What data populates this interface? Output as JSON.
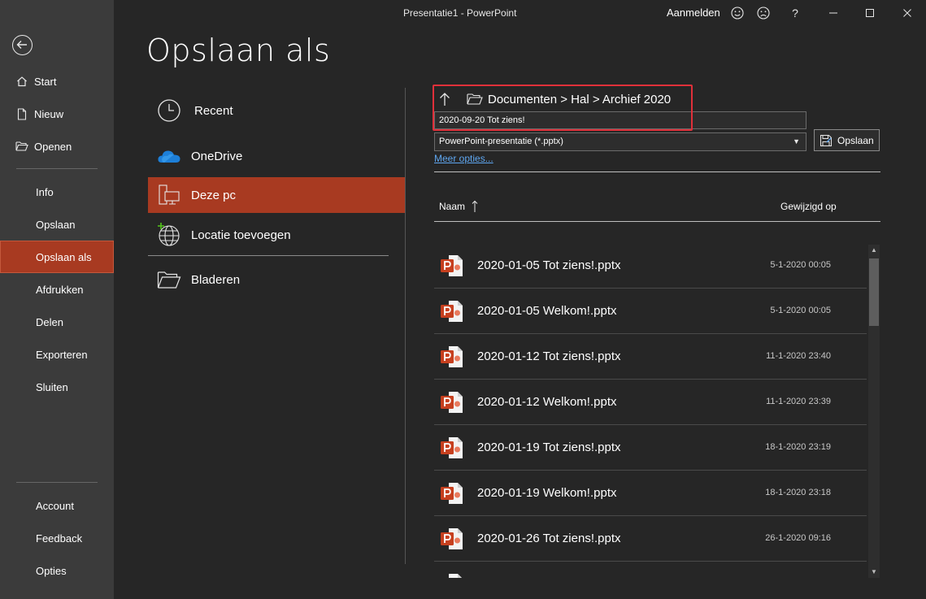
{
  "window": {
    "title": "Presentatie1  -  PowerPoint",
    "signin": "Aanmelden",
    "icons": [
      "smiley-icon",
      "frown-icon",
      "help-icon",
      "minimize-icon",
      "maximize-icon",
      "close-icon"
    ],
    "help_glyph": "?"
  },
  "sidebar": {
    "items": [
      {
        "label": "Start",
        "icon": "home-icon"
      },
      {
        "label": "Nieuw",
        "icon": "new-document-icon"
      },
      {
        "label": "Openen",
        "icon": "folder-open-icon"
      },
      {
        "label": "Info"
      },
      {
        "label": "Opslaan"
      },
      {
        "label": "Opslaan als",
        "selected": true
      },
      {
        "label": "Afdrukken"
      },
      {
        "label": "Delen"
      },
      {
        "label": "Exporteren"
      },
      {
        "label": "Sluiten"
      },
      {
        "label": "Account"
      },
      {
        "label": "Feedback"
      },
      {
        "label": "Opties"
      }
    ],
    "accent_color": "#a83a21"
  },
  "page": {
    "title": "Opslaan als"
  },
  "locations": [
    {
      "label": "Recent",
      "icon": "clock-icon"
    },
    {
      "label": "OneDrive",
      "icon": "onedrive-cloud-icon"
    },
    {
      "label": "Deze pc",
      "icon": "this-pc-icon",
      "selected": true
    },
    {
      "label": "Locatie toevoegen",
      "icon": "add-location-globe-icon"
    },
    {
      "label": "Bladeren",
      "icon": "folder-browse-icon"
    }
  ],
  "save": {
    "breadcrumb": "Documenten > Hal > Archief 2020",
    "filename": "2020-09-20 Tot ziens!",
    "filetype": "PowerPoint-presentatie (*.pptx)",
    "save_label": "Opslaan",
    "more_options": "Meer opties...",
    "highlight_color": "#e0303a"
  },
  "file_table": {
    "col_name": "Naam",
    "col_modified": "Gewijzigd op",
    "sort": "ascending",
    "rows": [
      {
        "name": "2020-01-05 Tot ziens!.pptx",
        "modified": "5-1-2020 00:05"
      },
      {
        "name": "2020-01-05 Welkom!.pptx",
        "modified": "5-1-2020 00:05"
      },
      {
        "name": "2020-01-12 Tot ziens!.pptx",
        "modified": "11-1-2020 23:40"
      },
      {
        "name": "2020-01-12 Welkom!.pptx",
        "modified": "11-1-2020 23:39"
      },
      {
        "name": "2020-01-19 Tot ziens!.pptx",
        "modified": "18-1-2020 23:19"
      },
      {
        "name": "2020-01-19 Welkom!.pptx",
        "modified": "18-1-2020 23:18"
      },
      {
        "name": "2020-01-26 Tot ziens!.pptx",
        "modified": "26-1-2020 09:16"
      },
      {
        "name": "",
        "modified": ""
      }
    ]
  }
}
